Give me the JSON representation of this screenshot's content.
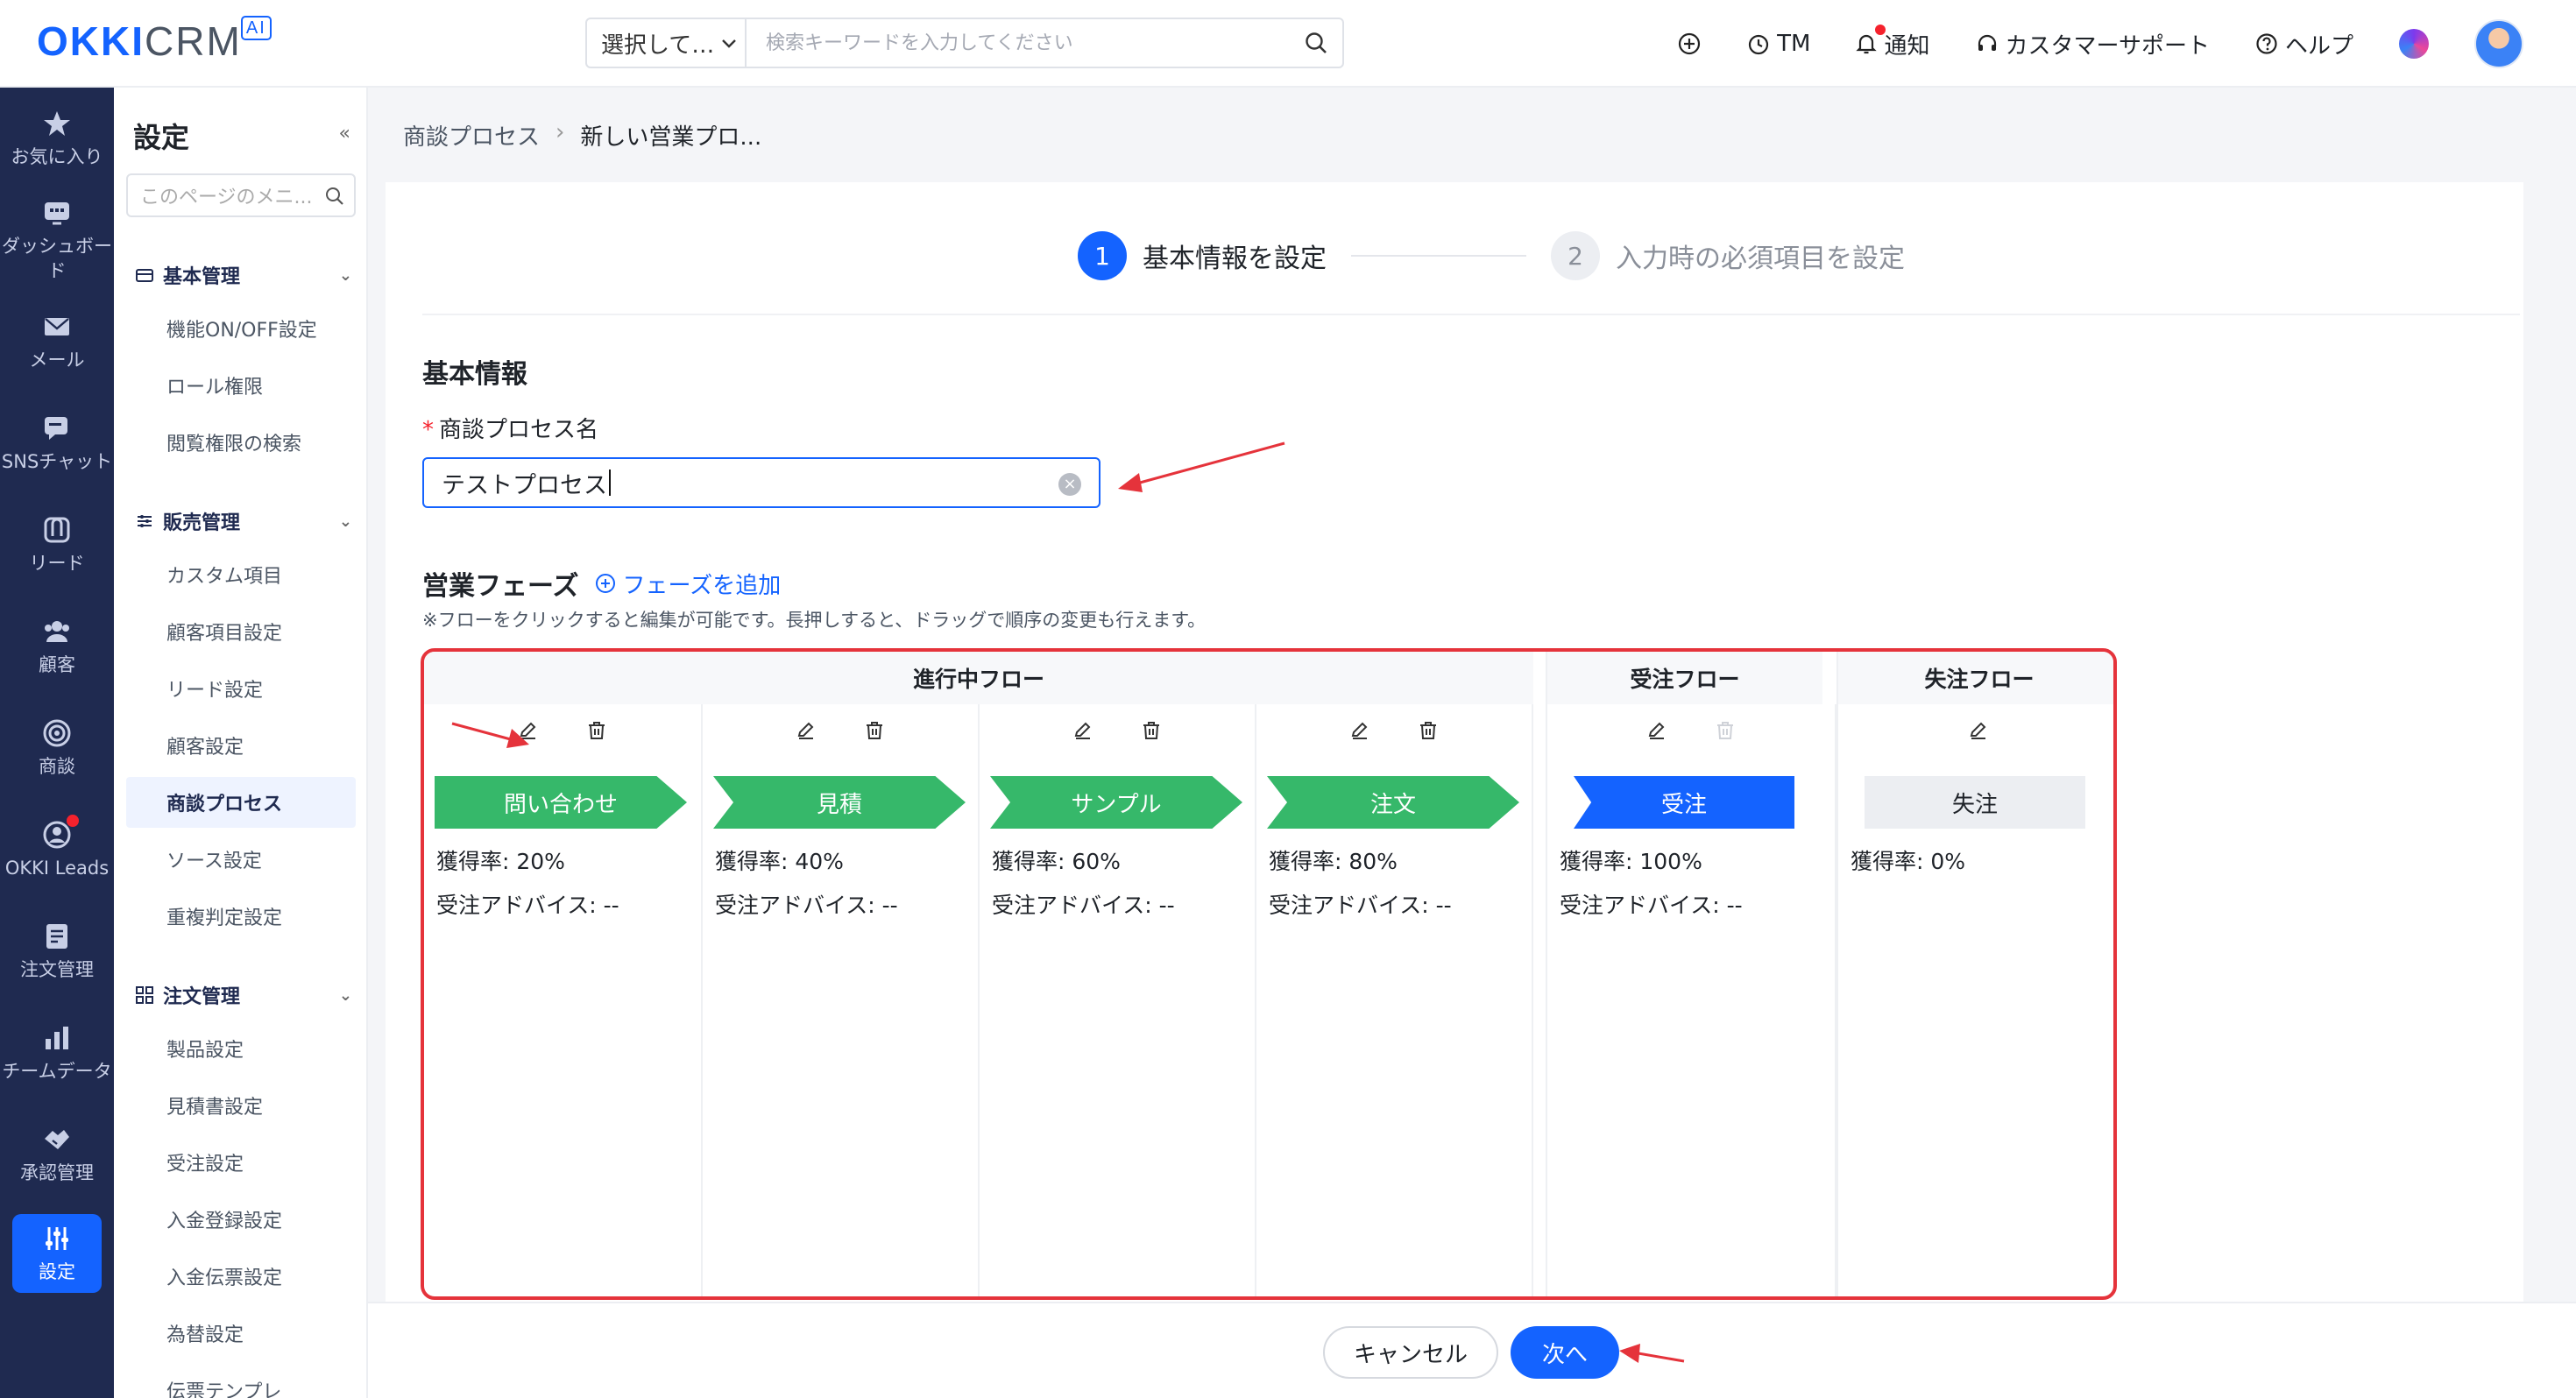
{
  "header": {
    "logo_main": "OKKI",
    "logo_crm": "CRM",
    "logo_ai": "AI",
    "search_select": "選択して…",
    "search_placeholder": "検索キーワードを入力してください",
    "tm_label": "TM",
    "notify_label": "通知",
    "support_label": "カスタマーサポート",
    "help_label": "ヘルプ"
  },
  "rail": [
    {
      "label": "お気に入り",
      "icon": "star-icon"
    },
    {
      "label": "ダッシュボード",
      "icon": "dashboard-icon"
    },
    {
      "label": "メール",
      "icon": "mail-icon"
    },
    {
      "label": "SNSチャット",
      "icon": "chat-icon"
    },
    {
      "label": "リード",
      "icon": "lead-icon"
    },
    {
      "label": "顧客",
      "icon": "customers-icon"
    },
    {
      "label": "商談",
      "icon": "target-icon"
    },
    {
      "label": "OKKI Leads",
      "icon": "okki-leads-icon"
    },
    {
      "label": "注文管理",
      "icon": "order-icon"
    },
    {
      "label": "チームデータ",
      "icon": "chart-icon"
    },
    {
      "label": "承認管理",
      "icon": "approval-icon"
    },
    {
      "label": "設定",
      "icon": "settings-icon"
    }
  ],
  "menu": {
    "title": "設定",
    "search_placeholder": "このページのメニ...",
    "groups": [
      {
        "label": "基本管理",
        "items": [
          "機能ON/OFF設定",
          "ロール権限",
          "閲覧権限の検索"
        ]
      },
      {
        "label": "販売管理",
        "items": [
          "カスタム項目",
          "顧客項目設定",
          "リード設定",
          "顧客設定",
          "商談プロセス",
          "ソース設定",
          "重複判定設定"
        ]
      },
      {
        "label": "注文管理",
        "items": [
          "製品設定",
          "見積書設定",
          "受注設定",
          "入金登録設定",
          "入金伝票設定",
          "為替設定",
          "伝票テンプレ"
        ]
      }
    ],
    "active_item": "商談プロセス"
  },
  "breadcrumb": {
    "parent": "商談プロセス",
    "separator": "›",
    "current": "新しい営業プロ..."
  },
  "steps": [
    {
      "num": "1",
      "label": "基本情報を設定",
      "active": true
    },
    {
      "num": "2",
      "label": "入力時の必須項目を設定",
      "active": false
    }
  ],
  "form": {
    "section_title": "基本情報",
    "name_label": "商談プロセス名",
    "required_mark": "*",
    "name_value": "テストプロセス"
  },
  "phases": {
    "title": "営業フェーズ",
    "add_label": "フェーズを追加",
    "note": "※フローをクリックすると編集が可能です。長押しすると、ドラッグで順序の変更も行えます。",
    "groups": {
      "in_progress": "進行中フロー",
      "won": "受注フロー",
      "lost": "失注フロー"
    },
    "stages": [
      {
        "name": "問い合わせ",
        "rate": "獲得率: 20%",
        "advice": "受注アドバイス: --",
        "type": "progress"
      },
      {
        "name": "見積",
        "rate": "獲得率: 40%",
        "advice": "受注アドバイス: --",
        "type": "progress"
      },
      {
        "name": "サンプル",
        "rate": "獲得率: 60%",
        "advice": "受注アドバイス: --",
        "type": "progress"
      },
      {
        "name": "注文",
        "rate": "獲得率: 80%",
        "advice": "受注アドバイス: --",
        "type": "progress"
      },
      {
        "name": "受注",
        "rate": "獲得率: 100%",
        "advice": "受注アドバイス: --",
        "type": "won"
      },
      {
        "name": "失注",
        "rate": "獲得率: 0%",
        "advice": "",
        "type": "lost"
      }
    ]
  },
  "footer": {
    "cancel_label": "キャンセル",
    "next_label": "次へ"
  },
  "colors": {
    "accent": "#1463ff",
    "green": "#36b86a",
    "highlight": "#e5333b",
    "rail": "#1f2a50"
  }
}
